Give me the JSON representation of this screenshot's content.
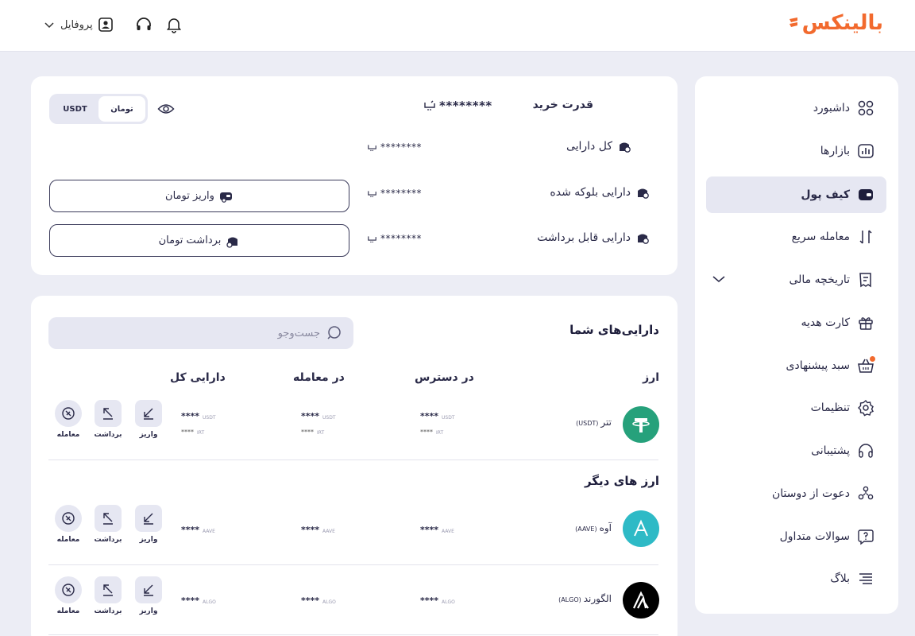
{
  "header": {
    "logo_text": "بالینکس",
    "profile_label": "پروفایل",
    "brand_color": "#F26A2E"
  },
  "sidebar": {
    "items": [
      {
        "label": "داشبورد",
        "icon": "dashboard-grid-icon"
      },
      {
        "label": "بازارها",
        "icon": "chart-bars-icon"
      },
      {
        "label": "کیف پول",
        "icon": "wallet-icon",
        "active": true
      },
      {
        "label": "معامله سریع",
        "icon": "swap-arrows-icon"
      },
      {
        "label": "تاریخچه مالی",
        "icon": "receipt-icon"
      },
      {
        "label": "کارت هدیه",
        "icon": "gift-icon"
      },
      {
        "label": "سبد پیشنهادی",
        "icon": "basket-icon"
      },
      {
        "label": "تنظیمات",
        "icon": "gear-icon"
      },
      {
        "label": "پشتیبانی",
        "icon": "headset-icon"
      },
      {
        "label": "دعوت از دوستان",
        "icon": "people-icon"
      },
      {
        "label": "سوالات متداول",
        "icon": "question-icon"
      },
      {
        "label": "بلاگ",
        "icon": "lines-icon"
      }
    ]
  },
  "balance": {
    "buying_power_label": "قدرت خرید",
    "buying_power_value": "********",
    "total_label": "کل دارایی",
    "total_value": "********",
    "blocked_label": "دارایی بلوکه شده",
    "blocked_value": "********",
    "withdrawable_label": "دارایی قابل برداشت",
    "withdrawable_value": "********",
    "toggle_toman": "تومان",
    "toggle_usdt": "USDT",
    "deposit_button": "واریز تومان",
    "withdraw_button": "برداشت تومان"
  },
  "assets": {
    "title": "دارایی‌های شما",
    "search_placeholder": "جست‌وجو",
    "columns": {
      "currency": "ارز",
      "available": "در دسترس",
      "in_trade": "در معامله",
      "total": "دارایی کل"
    },
    "actions": {
      "deposit": "واریز",
      "withdraw": "برداشت",
      "trade": "معامله"
    },
    "other_title": "ارز های دیگر",
    "rows": [
      {
        "name": "تتر",
        "symbol": "(USDT)",
        "unit": "USDT",
        "unit2": "IRT",
        "masked": "****",
        "color": "#26A17B"
      },
      {
        "name": "آوه",
        "symbol": "(AAVE)",
        "unit": "AAVE",
        "masked": "****",
        "color": "#2EBAC6"
      },
      {
        "name": "الگورند",
        "symbol": "(ALGO)",
        "unit": "ALGO",
        "masked": "****",
        "color": "#000000"
      }
    ]
  }
}
